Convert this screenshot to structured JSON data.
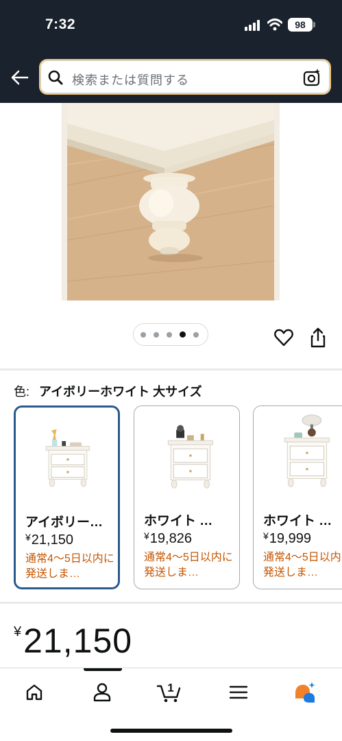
{
  "status": {
    "time": "7:32",
    "battery": "98"
  },
  "search": {
    "placeholder": "検索または質問する"
  },
  "carousel": {
    "total": 5,
    "active_index": 3
  },
  "color": {
    "label": "色:",
    "value": "アイボリーホワイト 大サイズ"
  },
  "variants": [
    {
      "title": "アイボリー…",
      "currency": "¥",
      "price": "21,150",
      "shipping": "通常4～5日以内に発送しま…",
      "selected": true
    },
    {
      "title": "ホワイト …",
      "currency": "¥",
      "price": "19,826",
      "shipping": "通常4～5日以内に発送しま…",
      "selected": false
    },
    {
      "title": "ホワイト …",
      "currency": "¥",
      "price": "19,999",
      "shipping": "通常4～5日以内に発送しま…",
      "selected": false
    }
  ],
  "price": {
    "currency": "¥",
    "value": "21,150"
  },
  "cart": {
    "count": "1"
  },
  "nav": [
    "home-icon",
    "account-icon",
    "cart-icon",
    "menu-icon",
    "rufus-icon"
  ],
  "colors": {
    "header_bg": "#1a222d",
    "selected_border": "#2a5a8c",
    "shipping_text": "#c45500",
    "rufus_orange": "#f0832a",
    "rufus_blue": "#1f7ae0"
  }
}
